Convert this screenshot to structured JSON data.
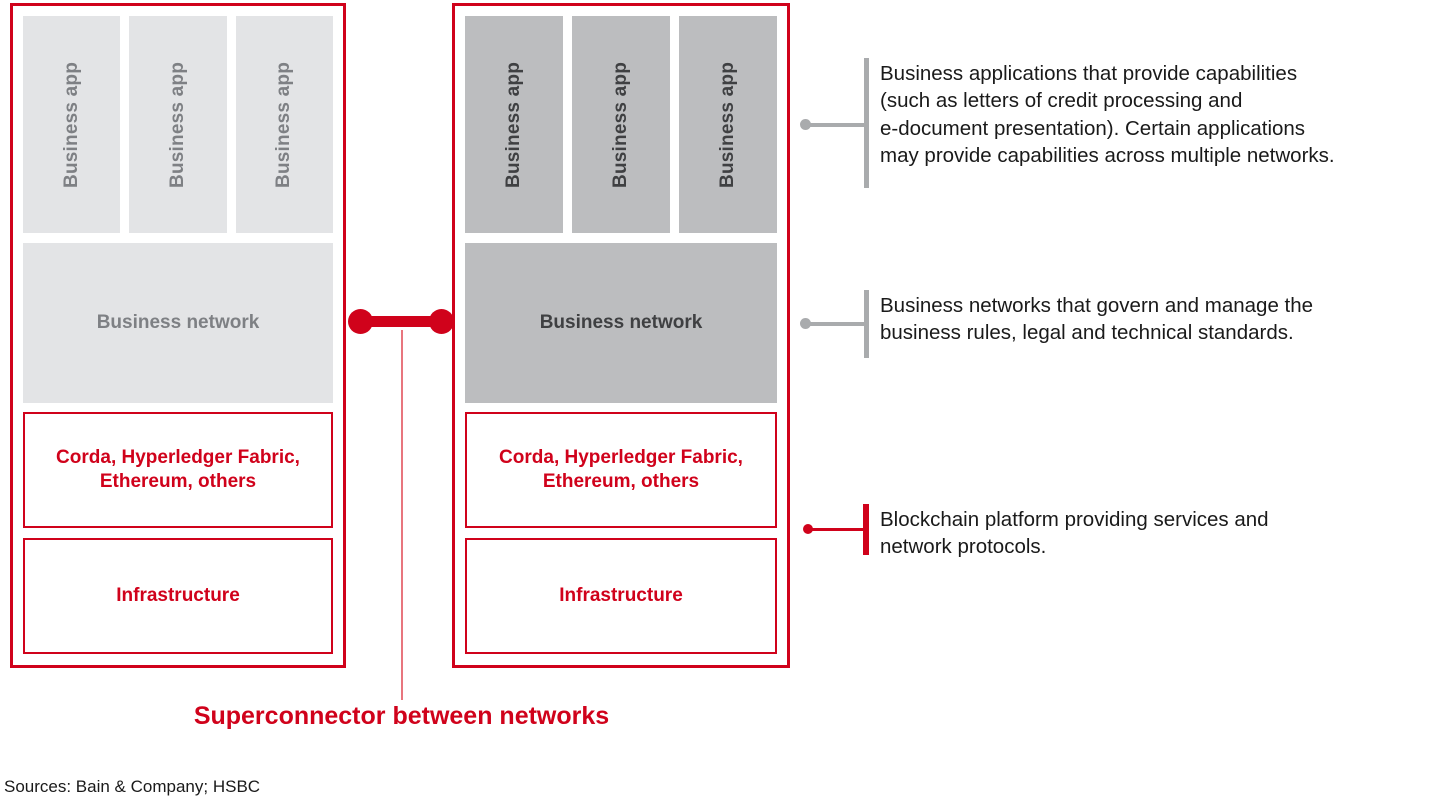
{
  "diagram": {
    "title": "Superconnector between networks",
    "panels": [
      {
        "id": "network-a",
        "theme": "light",
        "apps": [
          {
            "label": "Business app"
          },
          {
            "label": "Business app"
          },
          {
            "label": "Business app"
          }
        ],
        "network_label": "Business network",
        "platform_label": "Corda, Hyperledger\nFabric, Ethereum, others",
        "infrastructure_label": "Infrastructure"
      },
      {
        "id": "network-b",
        "theme": "dark",
        "apps": [
          {
            "label": "Business app"
          },
          {
            "label": "Business app"
          },
          {
            "label": "Business app"
          }
        ],
        "network_label": "Business network",
        "platform_label": "Corda, Hyperledger\nFabric, Ethereum, others",
        "infrastructure_label": "Infrastructure"
      }
    ],
    "connector_label": "Superconnector between networks"
  },
  "annotations": [
    {
      "id": "applications",
      "accent": "gray",
      "text": "Business applications that provide capabilities\n(such as letters of credit processing and\ne-document presentation). Certain applications\nmay provide capabilities across multiple networks."
    },
    {
      "id": "networks",
      "accent": "gray",
      "text": "Business networks that govern and manage the\nbusiness rules, legal and technical standards."
    },
    {
      "id": "platform",
      "accent": "red",
      "text": "Blockchain platform providing services and\nnetwork protocols."
    }
  ],
  "footer": {
    "sources": "Sources: Bain & Company; HSBC"
  },
  "colors": {
    "accent_red": "#d0021b",
    "panel_light_gray": "#e3e4e6",
    "panel_dark_gray": "#bcbdbf",
    "light_text_gray": "#7e8084",
    "dark_text_gray": "#3f4042",
    "annotation_gray": "#a9abad",
    "stem_pink": "#e8757e"
  }
}
